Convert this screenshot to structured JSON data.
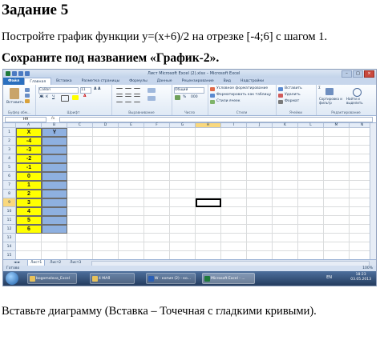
{
  "doc": {
    "heading": "Задание 5",
    "task_line": "Постройте график функции y=(x+6)/2 на отрезке [-4;6] с шагом 1.",
    "save_line": "Сохраните под названием «График-2».",
    "footer_line": "Вставьте диаграмму (Вставка – Точечная с гладкими кривыми)."
  },
  "excel": {
    "window_title": "Лист Microsoft Excel (2).xlsx – Microsoft Excel",
    "window_buttons": [
      "–",
      "□",
      "×"
    ],
    "ribbon_tabs": [
      "Файл",
      "Главная",
      "Вставка",
      "Разметка страницы",
      "Формулы",
      "Данные",
      "Рецензирование",
      "Вид",
      "Надстройки"
    ],
    "ribbon": {
      "paste_label": "Вставить",
      "clipboard_group": "Буфер обм...",
      "font_name": "Calibri",
      "font_size": "11",
      "font_group": "Шрифт",
      "alignment_group": "Выравнивание",
      "number_format": "Общий",
      "number_group": "Число",
      "conditional_format": "Условное форматирование",
      "format_as_table": "Форматировать как таблицу",
      "cell_styles": "Стили ячеек",
      "styles_group": "Стили",
      "insert_cells": "Вставить",
      "delete_cells": "Удалить",
      "format_cells": "Формат",
      "cells_group": "Ячейки",
      "sort_filter": "Сортировка и фильтр",
      "find_select": "Найти и выделить",
      "editing_group": "Редактирование"
    },
    "name_box": "H9",
    "fx_label": "fx",
    "columns": [
      "A",
      "B",
      "C",
      "D",
      "E",
      "F",
      "G",
      "H",
      "I",
      "J",
      "K",
      "L",
      "M",
      "N"
    ],
    "selected_column": "H",
    "selected_row": "9",
    "rows": [
      "1",
      "2",
      "3",
      "4",
      "5",
      "6",
      "7",
      "8",
      "9",
      "10",
      "11",
      "12",
      "13",
      "14",
      "15",
      "16",
      "17",
      "18",
      "19",
      "20",
      "21",
      "22"
    ],
    "table": {
      "header_x": "X",
      "header_y": "Y",
      "x_values": [
        "-4",
        "-3",
        "-2",
        "-1",
        "0",
        "1",
        "2",
        "3",
        "4",
        "5",
        "6"
      ]
    },
    "sheet_tabs": [
      "Лист1",
      "Лист2",
      "Лист3"
    ],
    "active_sheet": "Лист1",
    "status_text": "Готово",
    "zoom_level": "100%",
    "colors": {
      "x_fill": "#ffff00",
      "y_fill": "#8eb0e0",
      "accent": "#2a6fbf"
    }
  },
  "taskbar": {
    "items": [
      "bogomolova_Excel",
      "4 МАЯ",
      "W - копия (2) - ко...",
      "Microsoft Excel - ..."
    ],
    "language": "EN",
    "time": "18:23",
    "date": "03.05.2013"
  }
}
